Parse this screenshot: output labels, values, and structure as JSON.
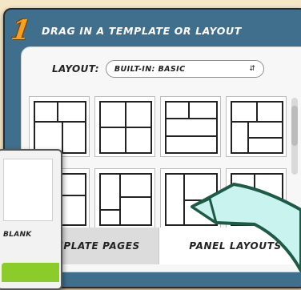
{
  "step": {
    "number": "1",
    "heading": "DRAG IN A TEMPLATE OR LAYOUT"
  },
  "layout": {
    "label": "LAYOUT:",
    "selected": "BUILT-IN: BASIC",
    "arrow_glyph": "⇵"
  },
  "tabs": {
    "templates": "TEMPLATE PAGES",
    "panels": "PANEL LAYOUTS"
  },
  "overlay": {
    "label": "BLANK"
  },
  "colors": {
    "panel_bg": "#3f6f8d",
    "step_number": "#f3a21a",
    "callout_fill": "#c8f3ef",
    "callout_stroke": "#1f5a46",
    "overlay_button": "#8ccc2a"
  },
  "icons": {
    "scroll": "scrollbar",
    "dropdown": "updown-arrows-icon",
    "callout": "arrow-callout"
  }
}
